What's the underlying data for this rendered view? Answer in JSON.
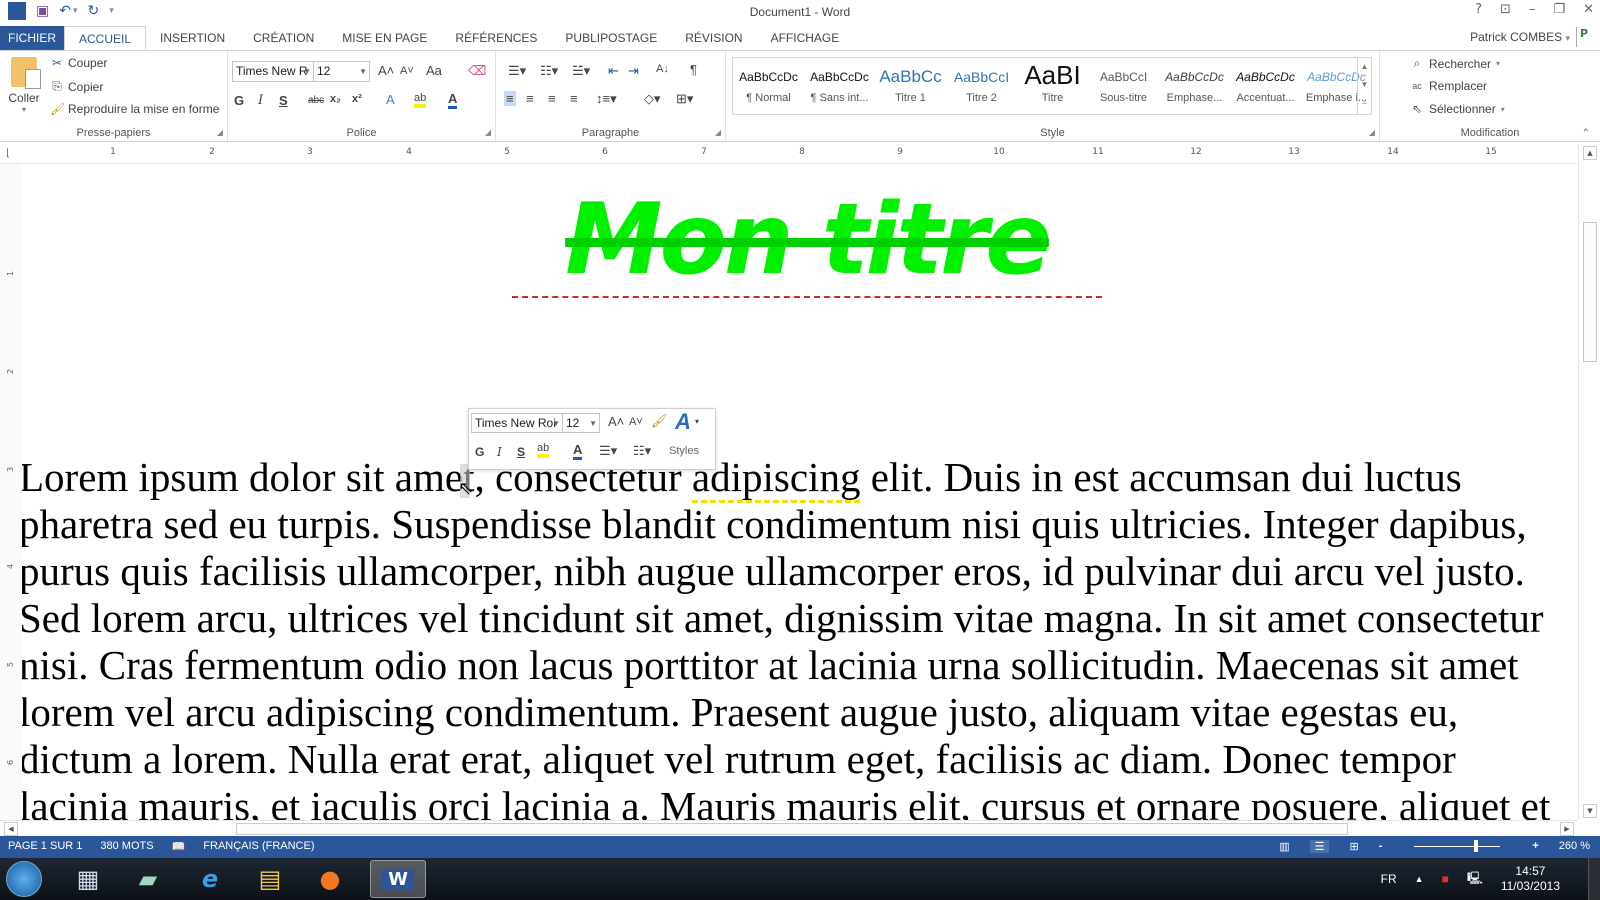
{
  "window": {
    "title": "Document1 - Word",
    "controls": {
      "help": "?",
      "ribbon_display": "⊡",
      "minimize": "–",
      "restore": "❐",
      "close": "✕"
    }
  },
  "qat": {
    "app_icon": "W",
    "save": "💾",
    "undo": "↶",
    "undo_dd": "▾",
    "redo": "↻",
    "customize": "⩡"
  },
  "tabs": [
    {
      "label": "FICHIER"
    },
    {
      "label": "ACCUEIL"
    },
    {
      "label": "INSERTION"
    },
    {
      "label": "CRÉATION"
    },
    {
      "label": "MISE EN PAGE"
    },
    {
      "label": "RÉFÉRENCES"
    },
    {
      "label": "PUBLIPOSTAGE"
    },
    {
      "label": "RÉVISION"
    },
    {
      "label": "AFFICHAGE"
    }
  ],
  "user": {
    "name": "Patrick COMBES",
    "dd": "▾",
    "icon": "P"
  },
  "ribbon": {
    "clipboard": {
      "label": "Presse-papiers",
      "paste": "Coller",
      "cut": "Couper",
      "copy": "Copier",
      "format_painter": "Reproduire la mise en forme"
    },
    "font": {
      "label": "Police",
      "font_name": "Times New R",
      "font_size": "12",
      "grow": "A˄",
      "shrink": "A˅",
      "case": "Aa",
      "bold": "G",
      "italic": "I",
      "underline": "S",
      "strike": "abc",
      "subscript": "x₂",
      "superscript": "x²",
      "effects": "A",
      "highlight": "ab",
      "font_color": "A"
    },
    "paragraph": {
      "label": "Paragraphe",
      "pilcrow": "¶",
      "sort": "A↓"
    },
    "styles": {
      "label": "Style",
      "items": [
        {
          "preview": "AaBbCcDc",
          "name": "¶ Normal"
        },
        {
          "preview": "AaBbCcDc",
          "name": "¶ Sans int..."
        },
        {
          "preview": "AaBbCc",
          "name": "Titre 1"
        },
        {
          "preview": "AaBbCcI",
          "name": "Titre 2"
        },
        {
          "preview": "AaBI",
          "name": "Titre"
        },
        {
          "preview": "AaBbCcI",
          "name": "Sous-titre"
        },
        {
          "preview": "AaBbCcDc",
          "name": "Emphase..."
        },
        {
          "preview": "AaBbCcDc",
          "name": "Accentuat..."
        },
        {
          "preview": "AaBbCcDc",
          "name": "Emphase i..."
        }
      ]
    },
    "editing": {
      "label": "Modification",
      "find": "Rechercher",
      "replace": "Remplacer",
      "select": "Sélectionner"
    }
  },
  "ruler": {
    "horizontal": [
      "1",
      "2",
      "3",
      "4",
      "5",
      "6",
      "7",
      "8",
      "9",
      "10",
      "11",
      "12",
      "13",
      "14",
      "15"
    ],
    "vertical": [
      "1",
      "2",
      "3",
      "4",
      "5",
      "6"
    ]
  },
  "document": {
    "heading": "Mon titre",
    "lines": [
      [
        "Lorem ipsum dolor sit amet, consectetur ",
        "adipiscing",
        " elit. Duis in est accumsan dui luctus"
      ],
      "pharetra sed eu turpis. Suspendisse blandit condimentum nisi quis ultricies. Integer dapibus,",
      "purus quis facilisis ullamcorper, nibh augue ullamcorper eros, id pulvinar dui arcu vel justo.",
      "Sed lorem arcu, ultrices vel tincidunt sit amet, dignissim vitae magna. In sit amet consectetur",
      "nisi. Cras fermentum odio non lacus porttitor at lacinia urna sollicitudin. Maecenas sit amet",
      "lorem vel arcu adipiscing condimentum. Praesent augue justo, aliquam vitae egestas eu,",
      "dictum a lorem. Nulla erat erat, aliquet vel rutrum eget, facilisis ac diam. Donec tempor",
      "lacinia mauris, et iaculis orci lacinia a. Mauris mauris elit, cursus et ornare posuere, aliquet et"
    ]
  },
  "mini_toolbar": {
    "font_name": "Times New Roi",
    "font_size": "12",
    "bold": "G",
    "italic": "I",
    "underline": "S",
    "styles": "Styles"
  },
  "status": {
    "page": "PAGE 1 SUR 1",
    "words": "380 MOTS",
    "language": "FRANÇAIS (FRANCE)",
    "zoom": "260 %",
    "zoom_minus": "-",
    "zoom_plus": "+"
  },
  "taskbar": {
    "apps": [
      "calculator",
      "notepad",
      "internet-explorer",
      "file-explorer",
      "firefox",
      "word"
    ],
    "lang": "FR",
    "time": "14:57",
    "date": "11/03/2013"
  },
  "colors": {
    "accent": "#2b579a",
    "heading": "#00f000"
  }
}
